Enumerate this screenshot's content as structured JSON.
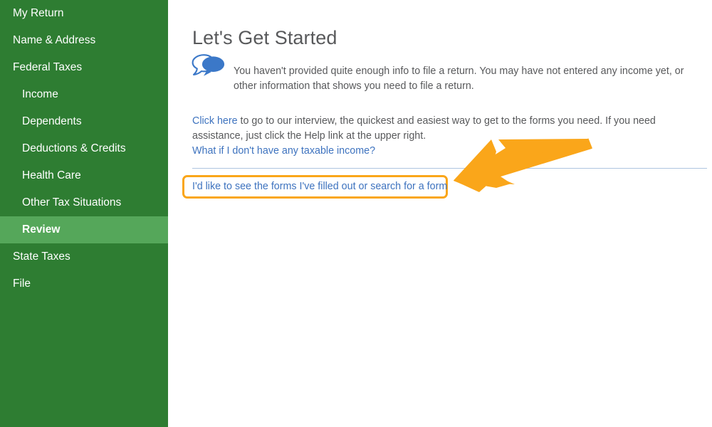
{
  "sidebar": {
    "background_color": "#2E7D32",
    "active_color": "#55A75A",
    "items": [
      {
        "label": "My Return",
        "level": 0,
        "active": false
      },
      {
        "label": "Name & Address",
        "level": 0,
        "active": false
      },
      {
        "label": "Federal Taxes",
        "level": 0,
        "active": false
      },
      {
        "label": "Income",
        "level": 1,
        "active": false
      },
      {
        "label": "Dependents",
        "level": 1,
        "active": false
      },
      {
        "label": "Deductions & Credits",
        "level": 1,
        "active": false
      },
      {
        "label": "Health Care",
        "level": 1,
        "active": false
      },
      {
        "label": "Other Tax Situations",
        "level": 1,
        "active": false
      },
      {
        "label": "Review",
        "level": 1,
        "active": true
      },
      {
        "label": "State Taxes",
        "level": 0,
        "active": false
      },
      {
        "label": "File",
        "level": 0,
        "active": false
      }
    ]
  },
  "main": {
    "title": "Let's Get Started",
    "notice": {
      "icon": "speech-bubbles-icon",
      "icon_color": "#3B78C8",
      "text": "You haven't provided quite enough info to file a return. You may have not entered any income yet, or other information that shows you need to file a return."
    },
    "interview": {
      "link_text": "Click here",
      "rest_text": " to go to our interview, the quickest and easiest way to get to the forms you need. If you need assistance, just click the Help link at the upper right."
    },
    "taxable_income_link": "What if I don't have any taxable income?",
    "forms_link": "I'd like to see the forms I've filled out or search for a form",
    "link_color": "#3E73BF",
    "text_color": "#58595B",
    "divider_color": "#AEC4E0"
  },
  "annotation": {
    "arrow": "arrow-pointing-left-at-forms-link",
    "color": "#FAA61A",
    "highlight_box_color": "#FAA61A"
  }
}
